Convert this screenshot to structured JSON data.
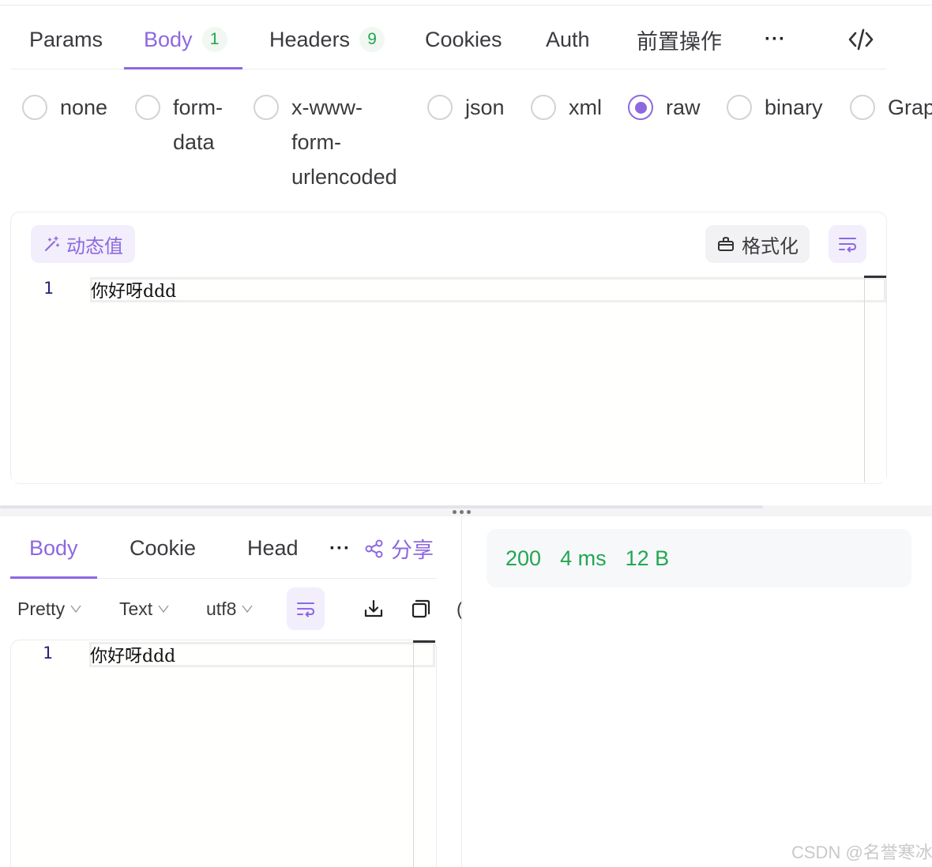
{
  "request_tabs": [
    {
      "label": "Params"
    },
    {
      "label": "Body",
      "badge": "1"
    },
    {
      "label": "Headers",
      "badge": "9"
    },
    {
      "label": "Cookies"
    },
    {
      "label": "Auth"
    },
    {
      "label": "前置操作"
    },
    {
      "label": "···"
    }
  ],
  "active_request_tab": "Body",
  "body_types": [
    {
      "label": "none"
    },
    {
      "label": "form-\ndata"
    },
    {
      "label": "x-www-\nform-\nurlencoded"
    },
    {
      "label": "json"
    },
    {
      "label": "xml"
    },
    {
      "label": "raw"
    },
    {
      "label": "binary"
    },
    {
      "label": "Grap"
    }
  ],
  "selected_body_type": "raw",
  "editor": {
    "dynamic_value_label": "动态值",
    "format_label": "格式化",
    "lines": [
      {
        "number": "1",
        "text": "你好呀ddd"
      }
    ]
  },
  "response_tabs": [
    {
      "label": "Body"
    },
    {
      "label": "Cookie"
    },
    {
      "label": "Head"
    },
    {
      "label": "···"
    },
    {
      "label": "分享"
    }
  ],
  "response_tools": {
    "view_mode": "Pretty",
    "content_type": "Text",
    "encoding": "utf8",
    "cut_off_glyph": "("
  },
  "response_editor": {
    "lines": [
      {
        "number": "1",
        "text": "你好呀ddd"
      }
    ]
  },
  "status": {
    "code": "200",
    "time": "4 ms",
    "size": "12 B"
  },
  "colors": {
    "accent": "#8d68e0",
    "success": "#22a653"
  },
  "watermark": "CSDN @名誉寒冰"
}
